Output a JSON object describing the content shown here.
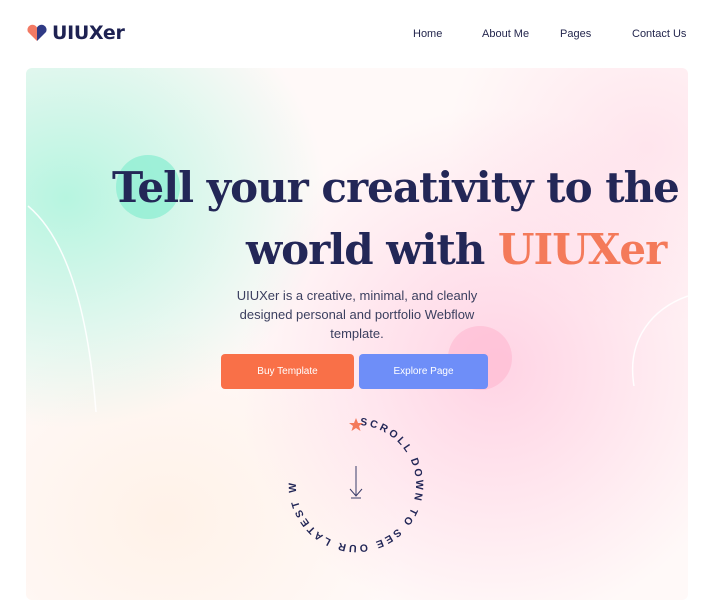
{
  "brand": {
    "name": "UIUXer",
    "logo_icon": "heart-logo-icon"
  },
  "nav": {
    "home": "Home",
    "about": "About Me",
    "pages": "Pages",
    "contact": "Contact Us"
  },
  "hero": {
    "headline_line1": "Tell your creativity to the",
    "headline_line2_prefix": "world with ",
    "headline_accent": "UIUXer",
    "subtext": "UIUXer is a creative, minimal, and cleanly designed personal and portfolio Webflow template.",
    "buy_button": "Buy Template",
    "explore_button": "Explore Page",
    "scroll_text": "SCROLL DOWN TO SEE OUR LATEST WORK",
    "scroll_icon": "arrow-down-icon",
    "star_icon": "star-icon"
  },
  "colors": {
    "accent": "#f47a5a",
    "primary_text": "#232757",
    "buy_button": "#f97048",
    "explore_button": "#6e8ef8"
  }
}
